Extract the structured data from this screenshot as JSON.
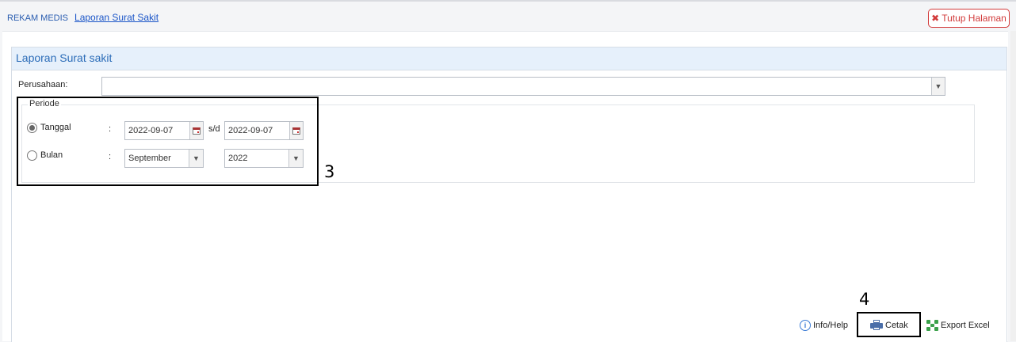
{
  "breadcrumb": {
    "root": "REKAM MEDIS",
    "current": "Laporan Surat Sakit"
  },
  "close_button": {
    "label": "Tutup Halaman",
    "icon": "close-x-icon",
    "color": "#d23a3a"
  },
  "panel": {
    "title": "Laporan Surat sakit",
    "header_color": "#e6f0fb"
  },
  "form": {
    "perusahaan_label": "Perusahaan:",
    "perusahaan_value": "",
    "periode_legend": "Periode",
    "mode_selected": "tanggal",
    "tanggal_label": "Tanggal",
    "bulan_label": "Bulan",
    "colon": ":",
    "date_from": "2022-09-07",
    "sd_label": "s/d",
    "date_to": "2022-09-07",
    "month": "September",
    "year": "2022"
  },
  "footer": {
    "info_label": "Info/Help",
    "print_label": "Cetak",
    "export_label": "Export Excel"
  },
  "annotations": {
    "box3": "3",
    "box4": "4"
  }
}
